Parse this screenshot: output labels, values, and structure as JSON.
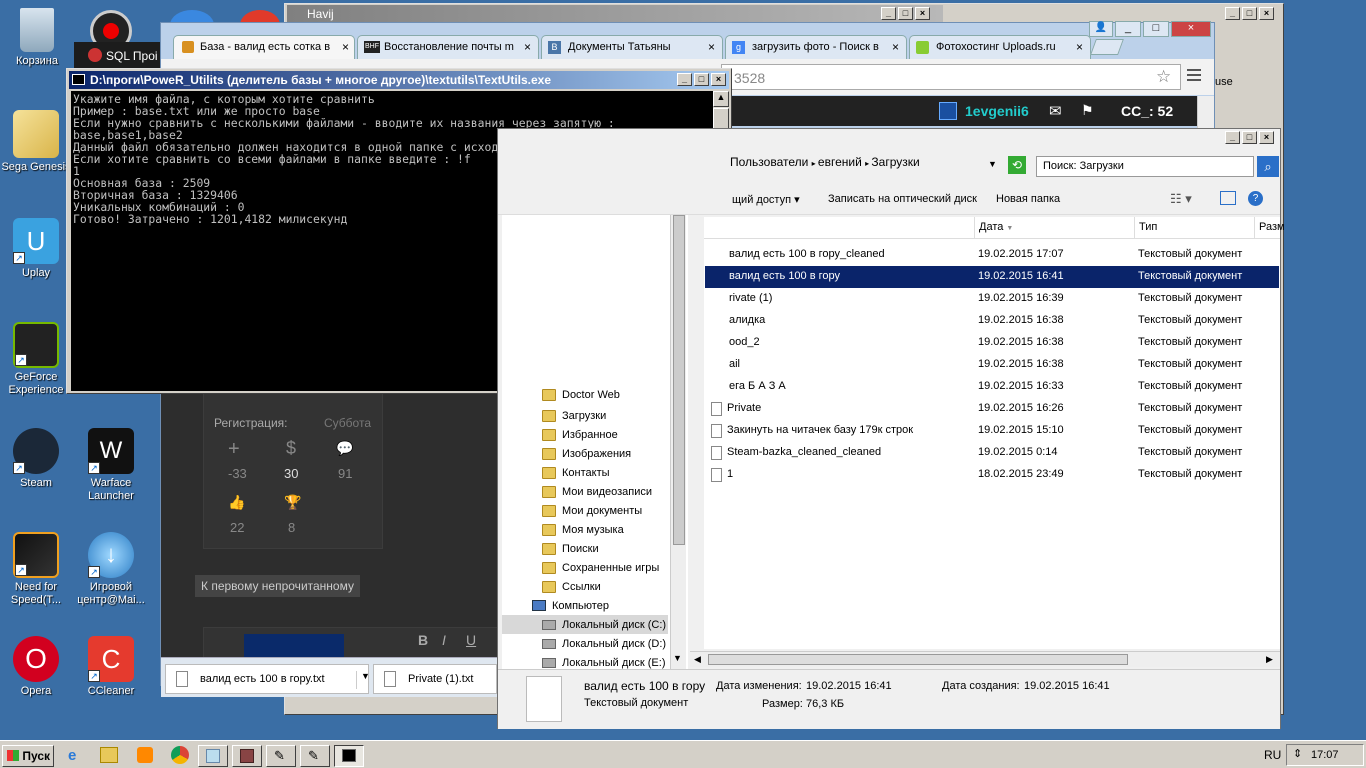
{
  "desktop": {
    "icons": [
      {
        "label": "Корзина"
      },
      {
        "label": "Sega Genesis"
      },
      {
        "label": "Uplay"
      },
      {
        "label": "GeForce Experience"
      },
      {
        "label": "Steam"
      },
      {
        "label": "Warface Launcher"
      },
      {
        "label": "Need for Speed(T..."
      },
      {
        "label": "Игровой центр@Mai..."
      },
      {
        "label": "Opera"
      },
      {
        "label": "CCleaner"
      }
    ]
  },
  "sql_window": {
    "title": "SQL Проі"
  },
  "havij_window": {
    "title": "Havij"
  },
  "browser": {
    "tabs": [
      {
        "label": "База - валид есть сотка в"
      },
      {
        "label": "Восстановление почты m"
      },
      {
        "label": "Документы Татьяны"
      },
      {
        "label": "загрузить фото - Поиск в"
      },
      {
        "label": "Фотохостинг Uploads.ru"
      }
    ],
    "address_fragment": "3528",
    "user": "1evgenii6",
    "counter": "CC_: 52",
    "side_fragment": "use"
  },
  "console": {
    "title": "D:\\проги\\PoweR_Utilits (делитель базы + многое другое)\\textutils\\TextUtils.exe",
    "lines": "Укажите имя файла, с которым хотите сравнить\nПример : base.txt или же просто base\nЕсли нужно сравнить с несколькими файлами - вводите их названия через запятую :\nbase,base1,base2\nДанный файл обязательно должен находится в одной папке с исходным\nЕсли хотите сравнить со всеми файлами в папке введите : !f\n1\nОсновная база : 2509\nВторичная база : 1329406\nУникальных комбинаций : 0\nГотово! Затрачено : 1201,4182 милисекунд"
  },
  "forum": {
    "reg_label": "Регистрация:",
    "reg_value": "Суббота",
    "stats": [
      "-33",
      "30",
      "91",
      "22",
      "8"
    ],
    "unread_button": "К первому непрочитанному",
    "editor_buttons": [
      "B",
      "I",
      "U"
    ]
  },
  "downloads": {
    "items": [
      {
        "name": "валид есть 100 в гору.txt"
      },
      {
        "name": "Private (1).txt"
      }
    ]
  },
  "explorer": {
    "breadcrumb": [
      "Пользователи",
      "евгений",
      "Загрузки"
    ],
    "search_placeholder": "Поиск: Загрузки",
    "toolbar": {
      "share": "щий доступ",
      "burn": "Записать на оптический диск",
      "new_folder": "Новая папка"
    },
    "columns": {
      "date": "Дата",
      "type": "Тип",
      "size": "Разм"
    },
    "tree": [
      {
        "label": "Doctor Web"
      },
      {
        "label": "Загрузки"
      },
      {
        "label": "Избранное"
      },
      {
        "label": "Изображения"
      },
      {
        "label": "Контакты"
      },
      {
        "label": "Мои видеозаписи"
      },
      {
        "label": "Мои документы"
      },
      {
        "label": "Моя музыка"
      },
      {
        "label": "Поиски"
      },
      {
        "label": "Сохраненные игры"
      },
      {
        "label": "Ссылки"
      },
      {
        "label": "Компьютер"
      },
      {
        "label": "Локальный диск (C:)"
      },
      {
        "label": "Локальный диск (D:)"
      },
      {
        "label": "Локальный диск (E:)"
      }
    ],
    "files": [
      {
        "name": "валид есть 100 в гору_cleaned",
        "date": "19.02.2015 17:07",
        "type": "Текстовый документ"
      },
      {
        "name": "валид есть 100 в гору",
        "date": "19.02.2015 16:41",
        "type": "Текстовый документ"
      },
      {
        "name": "rivate (1)",
        "date": "19.02.2015 16:39",
        "type": "Текстовый документ"
      },
      {
        "name": "алидка",
        "date": "19.02.2015 16:38",
        "type": "Текстовый документ"
      },
      {
        "name": "ood_2",
        "date": "19.02.2015 16:38",
        "type": "Текстовый документ"
      },
      {
        "name": "ail",
        "date": "19.02.2015 16:38",
        "type": "Текстовый документ"
      },
      {
        "name": "ега Б А З А",
        "date": "19.02.2015 16:33",
        "type": "Текстовый документ"
      },
      {
        "name": "Private",
        "date": "19.02.2015 16:26",
        "type": "Текстовый документ"
      },
      {
        "name": "Закинуть на читачек базу 179к строк",
        "date": "19.02.2015 15:10",
        "type": "Текстовый документ"
      },
      {
        "name": "Steam-bazka_cleaned_cleaned",
        "date": "19.02.2015 0:14",
        "type": "Текстовый документ"
      },
      {
        "name": "1",
        "date": "18.02.2015 23:49",
        "type": "Текстовый документ"
      }
    ],
    "details": {
      "name": "валид есть 100 в гору",
      "type": "Текстовый документ",
      "modified_label": "Дата изменения:",
      "modified_value": "19.02.2015 16:41",
      "created_label": "Дата создания:",
      "created_value": "19.02.2015 16:41",
      "size_label": "Размер:",
      "size_value": "76,3 КБ"
    }
  },
  "taskbar": {
    "start": "Пуск",
    "lang": "RU",
    "clock": "17:07"
  }
}
